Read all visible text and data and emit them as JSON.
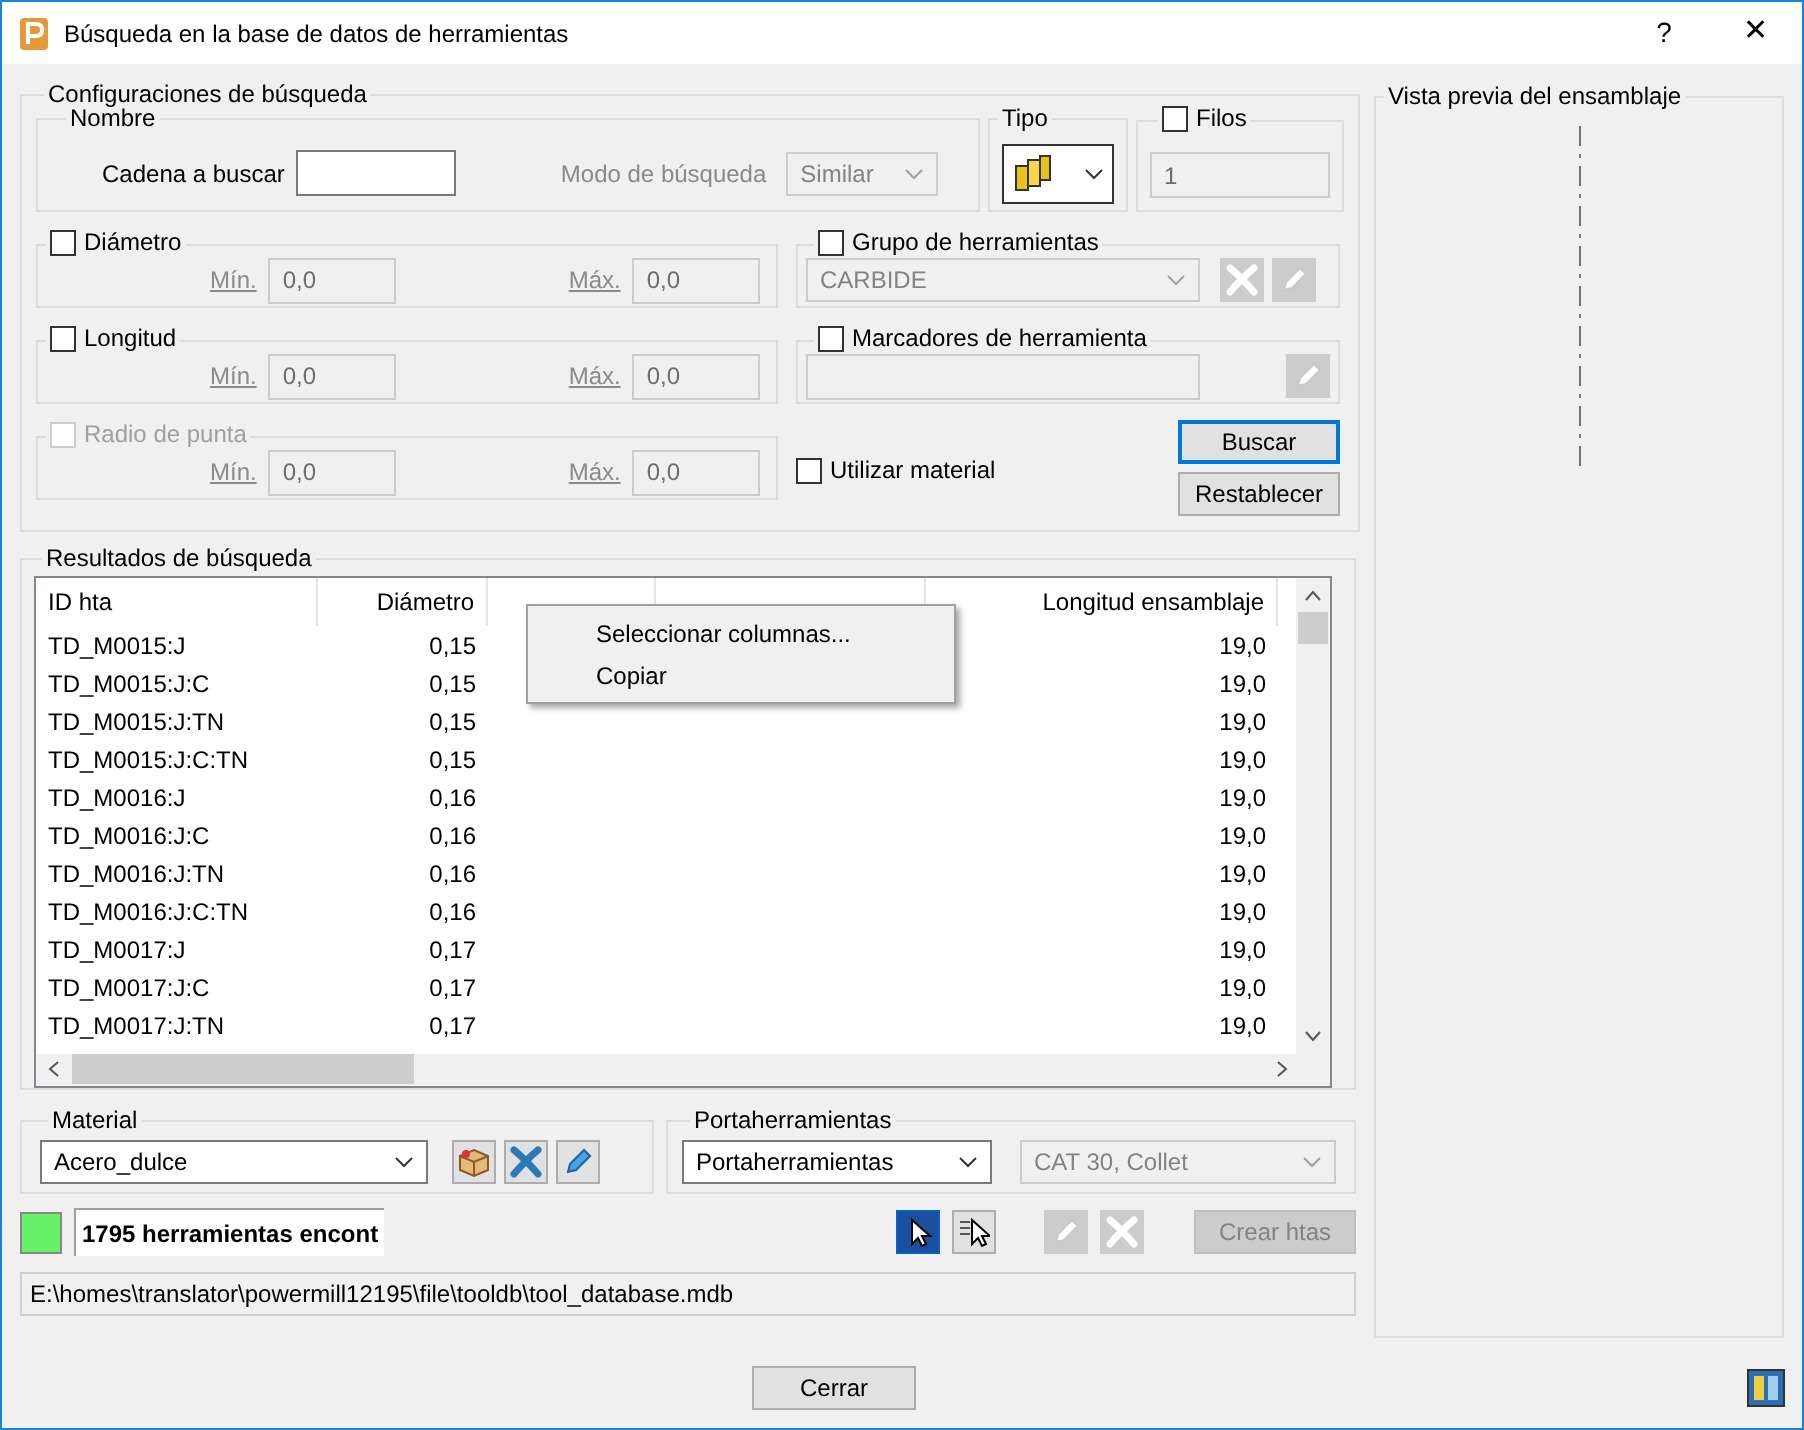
{
  "window": {
    "title": "Búsqueda en la base de datos de herramientas",
    "help": "?",
    "close": "✕"
  },
  "search": {
    "legend": "Configuraciones de búsqueda",
    "name": {
      "legend": "Nombre",
      "string_label": "Cadena a buscar",
      "mode_label": "Modo de búsqueda",
      "mode": "Similar"
    },
    "type": {
      "legend": "Tipo"
    },
    "flutes": {
      "label": "Filos",
      "checked": false,
      "value": "1"
    },
    "ranges": [
      {
        "label": "Diámetro",
        "checked": false,
        "disabled": false,
        "min_label": "Mín.",
        "min": "0,0",
        "max_label": "Máx.",
        "max": "0,0"
      },
      {
        "label": "Longitud",
        "checked": false,
        "disabled": false,
        "min_label": "Mín.",
        "min": "0,0",
        "max_label": "Máx.",
        "max": "0,0"
      },
      {
        "label": "Radio de punta",
        "checked": false,
        "disabled": true,
        "min_label": "Mín.",
        "min": "0,0",
        "max_label": "Máx.",
        "max": "0,0"
      }
    ],
    "tool_group": {
      "label": "Grupo de herramientas",
      "checked": false,
      "value": "CARBIDE"
    },
    "markers": {
      "label": "Marcadores de herramienta",
      "checked": false
    },
    "use_material": {
      "label": "Utilizar material",
      "checked": false
    },
    "buttons": [
      {
        "label": "Buscar",
        "focused": true
      },
      {
        "label": "Restablecer",
        "focused": false
      }
    ]
  },
  "results": {
    "legend": "Resultados de búsqueda",
    "columns": [
      {
        "label": "ID hta"
      },
      {
        "label": "Diámetro"
      },
      {
        "label": "Longitud ensamblaje"
      }
    ],
    "rows": [
      {
        "id": "TD_M0015:J",
        "diameter": "0,15",
        "assembly_length": "19,0"
      },
      {
        "id": "TD_M0015:J:C",
        "diameter": "0,15",
        "assembly_length": "19,0"
      },
      {
        "id": "TD_M0015:J:TN",
        "diameter": "0,15",
        "assembly_length": "19,0"
      },
      {
        "id": "TD_M0015:J:C:TN",
        "diameter": "0,15",
        "assembly_length": "19,0"
      },
      {
        "id": "TD_M0016:J",
        "diameter": "0,16",
        "assembly_length": "19,0"
      },
      {
        "id": "TD_M0016:J:C",
        "diameter": "0,16",
        "assembly_length": "19,0"
      },
      {
        "id": "TD_M0016:J:TN",
        "diameter": "0,16",
        "assembly_length": "19,0"
      },
      {
        "id": "TD_M0016:J:C:TN",
        "diameter": "0,16",
        "assembly_length": "19,0"
      },
      {
        "id": "TD_M0017:J",
        "diameter": "0,17",
        "assembly_length": "19,0"
      },
      {
        "id": "TD_M0017:J:C",
        "diameter": "0,17",
        "assembly_length": "19,0"
      },
      {
        "id": "TD_M0017:J:TN",
        "diameter": "0,17",
        "assembly_length": "19,0"
      }
    ],
    "context_menu": [
      "Seleccionar columnas...",
      "Copiar"
    ]
  },
  "material": {
    "legend": "Material",
    "value": "Acero_dulce"
  },
  "holder": {
    "legend": "Portaherramientas",
    "value": "Portaherramientas",
    "holder_value": "CAT 30, Collet"
  },
  "status": {
    "text": "1795 herramientas encont"
  },
  "create_button": {
    "label": "Crear htas",
    "disabled": true
  },
  "path": "E:\\homes\\translator\\powermill12195\\file\\tooldb\\tool_database.mdb",
  "preview": {
    "legend": "Vista previa del ensamblaje"
  },
  "close_button": "Cerrar"
}
